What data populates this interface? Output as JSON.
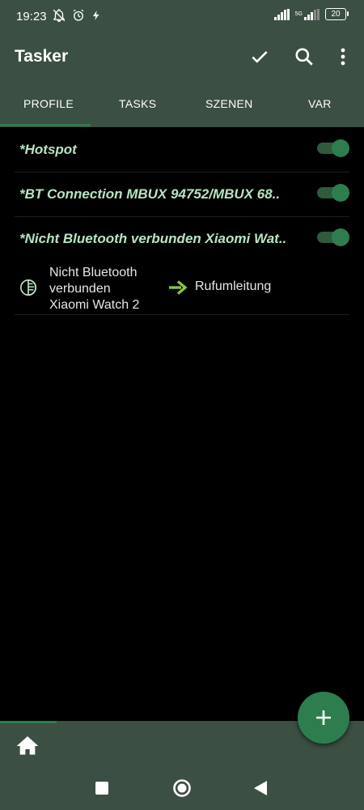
{
  "status": {
    "time": "19:23",
    "network": "5G",
    "battery": "20"
  },
  "app": {
    "title": "Tasker"
  },
  "tabs": [
    {
      "label": "PROFILE",
      "active": true
    },
    {
      "label": "TASKS",
      "active": false
    },
    {
      "label": "SZENEN",
      "active": false
    },
    {
      "label": "VAR",
      "active": false
    }
  ],
  "profiles": [
    {
      "name": "*Hotspot",
      "enabled": true
    },
    {
      "name": "*BT Connection MBUX 94752/MBUX 68..",
      "enabled": true
    },
    {
      "name": "*Nicht Bluetooth verbunden Xiaomi Wat..",
      "enabled": true
    }
  ],
  "expanded_profile": {
    "context_lines": [
      "Nicht Bluetooth",
      "verbunden",
      "Xiaomi Watch 2"
    ],
    "task": "Rufumleitung"
  },
  "colors": {
    "bar": "#3b4f42",
    "accent": "#2e7d4f",
    "profile_text": "#b7e4c3",
    "arrow": "#8bc34a"
  },
  "icons": {
    "check": "check-icon",
    "search": "search-icon",
    "more": "more-vert-icon",
    "add": "add-icon",
    "home": "home-icon",
    "context": "bluetooth-context-icon",
    "arrow": "arrow-right-icon"
  }
}
